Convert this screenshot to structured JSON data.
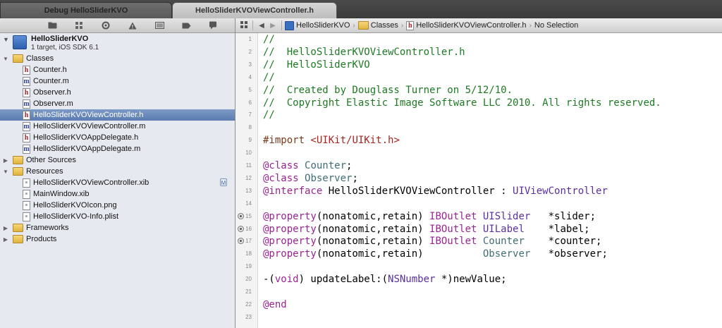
{
  "tabs": [
    {
      "label": "Debug HelloSliderKVO",
      "active": false
    },
    {
      "label": "HelloSliderKVOViewController.h",
      "active": true
    }
  ],
  "navigator_toolbar": {
    "icons": [
      "folder-icon",
      "symbol-icon",
      "search-icon",
      "warning-icon",
      "test-icon",
      "breakpoint-icon",
      "log-icon"
    ]
  },
  "jumpbar": {
    "grid_icon": "related-items-icon",
    "back": "◀",
    "forward": "▶",
    "crumbs": [
      "HelloSliderKVO",
      "Classes",
      "HelloSliderKVOViewController.h",
      "No Selection"
    ]
  },
  "project": {
    "name": "HelloSliderKVO",
    "subtitle": "1 target, iOS SDK 6.1"
  },
  "navigator": [
    {
      "label": "Classes",
      "kind": "folder",
      "level": 1,
      "disclosure": "open"
    },
    {
      "label": "Counter.h",
      "kind": "h",
      "level": 2
    },
    {
      "label": "Counter.m",
      "kind": "m",
      "level": 2
    },
    {
      "label": "Observer.h",
      "kind": "h",
      "level": 2
    },
    {
      "label": "Observer.m",
      "kind": "m",
      "level": 2
    },
    {
      "label": "HelloSliderKVOViewController.h",
      "kind": "h",
      "level": 2,
      "selected": true
    },
    {
      "label": "HelloSliderKVOViewController.m",
      "kind": "m",
      "level": 2
    },
    {
      "label": "HelloSliderKVOAppDelegate.h",
      "kind": "h",
      "level": 2
    },
    {
      "label": "HelloSliderKVOAppDelegate.m",
      "kind": "m",
      "level": 2
    },
    {
      "label": "Other Sources",
      "kind": "folder",
      "level": 1,
      "disclosure": "closed"
    },
    {
      "label": "Resources",
      "kind": "folder",
      "level": 1,
      "disclosure": "open"
    },
    {
      "label": "HelloSliderKVOViewController.xib",
      "kind": "doc",
      "level": 2,
      "badge": "M"
    },
    {
      "label": "MainWindow.xib",
      "kind": "doc",
      "level": 2
    },
    {
      "label": "HelloSliderKVOIcon.png",
      "kind": "doc",
      "level": 2
    },
    {
      "label": "HelloSliderKVO-Info.plist",
      "kind": "doc",
      "level": 2
    },
    {
      "label": "Frameworks",
      "kind": "folder",
      "level": 1,
      "disclosure": "closed"
    },
    {
      "label": "Products",
      "kind": "folder",
      "level": 1,
      "disclosure": "closed"
    }
  ],
  "editor": {
    "line_numbers": [
      "1",
      "2",
      "3",
      "4",
      "5",
      "6",
      "7",
      "8",
      "9",
      "10",
      "11",
      "12",
      "13",
      "14",
      "15",
      "16",
      "17",
      "18",
      "19",
      "20",
      "21",
      "22",
      "23"
    ],
    "breakpoint_lines": [
      15,
      16,
      17
    ],
    "code_lines": [
      [
        [
          "c-comment",
          "//"
        ]
      ],
      [
        [
          "c-comment",
          "//  HelloSliderKVOViewController.h"
        ]
      ],
      [
        [
          "c-comment",
          "//  HelloSliderKVO"
        ]
      ],
      [
        [
          "c-comment",
          "//"
        ]
      ],
      [
        [
          "c-comment",
          "//  Created by Douglass Turner on 5/12/10."
        ]
      ],
      [
        [
          "c-comment",
          "//  Copyright Elastic Image Software LLC 2010. All rights reserved."
        ]
      ],
      [
        [
          "c-comment",
          "//"
        ]
      ],
      [],
      [
        [
          "c-directive",
          "#import "
        ],
        [
          "c-string",
          "<UIKit/UIKit.h>"
        ]
      ],
      [],
      [
        [
          "c-kw",
          "@class "
        ],
        [
          "c-type",
          "Counter"
        ],
        [
          "c-plain",
          ";"
        ]
      ],
      [
        [
          "c-kw",
          "@class "
        ],
        [
          "c-type",
          "Observer"
        ],
        [
          "c-plain",
          ";"
        ]
      ],
      [
        [
          "c-kw",
          "@interface "
        ],
        [
          "c-plain",
          "HelloSliderKVOViewController : "
        ],
        [
          "c-cls",
          "UIViewController"
        ]
      ],
      [],
      [
        [
          "c-kw",
          "@property"
        ],
        [
          "c-plain",
          "(nonatomic,retain) "
        ],
        [
          "c-kw",
          "IBOutlet "
        ],
        [
          "c-cls",
          "UISlider"
        ],
        [
          "c-plain",
          "   *slider;"
        ]
      ],
      [
        [
          "c-kw",
          "@property"
        ],
        [
          "c-plain",
          "(nonatomic,retain) "
        ],
        [
          "c-kw",
          "IBOutlet "
        ],
        [
          "c-cls",
          "UILabel"
        ],
        [
          "c-plain",
          "    *label;"
        ]
      ],
      [
        [
          "c-kw",
          "@property"
        ],
        [
          "c-plain",
          "(nonatomic,retain) "
        ],
        [
          "c-kw",
          "IBOutlet "
        ],
        [
          "c-type",
          "Counter"
        ],
        [
          "c-plain",
          "    *counter;"
        ]
      ],
      [
        [
          "c-kw",
          "@property"
        ],
        [
          "c-plain",
          "(nonatomic,retain)          "
        ],
        [
          "c-type",
          "Observer"
        ],
        [
          "c-plain",
          "   *observer;"
        ]
      ],
      [],
      [
        [
          "c-plain",
          "-("
        ],
        [
          "c-kw",
          "void"
        ],
        [
          "c-plain",
          ") updateLabel:("
        ],
        [
          "c-cls",
          "NSNumber"
        ],
        [
          "c-plain",
          " *)newValue;"
        ]
      ],
      [],
      [
        [
          "c-kw",
          "@end"
        ]
      ],
      []
    ]
  }
}
